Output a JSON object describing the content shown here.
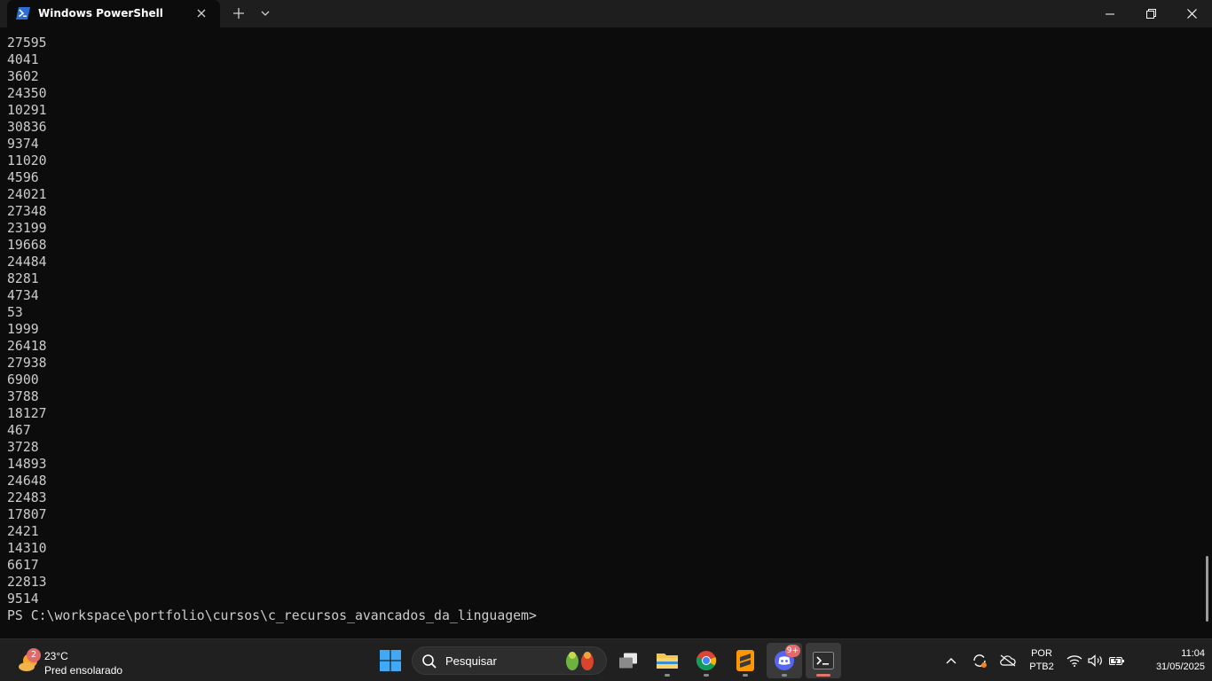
{
  "window": {
    "tab_title": "Windows PowerShell",
    "tab_icon": "powershell-icon"
  },
  "terminal": {
    "output_lines": [
      "27595",
      "4041",
      "3602",
      "24350",
      "10291",
      "30836",
      "9374",
      "11020",
      "4596",
      "24021",
      "27348",
      "23199",
      "19668",
      "24484",
      "8281",
      "4734",
      "53",
      "1999",
      "26418",
      "27938",
      "6900",
      "3788",
      "18127",
      "467",
      "3728",
      "14893",
      "24648",
      "22483",
      "17807",
      "2421",
      "14310",
      "6617",
      "22813",
      "9514"
    ],
    "prompt": "PS C:\\workspace\\portfolio\\cursos\\c_recursos_avancados_da_linguagem>"
  },
  "taskbar": {
    "weather": {
      "badge": "2",
      "temperature": "23°C",
      "description": "Pred ensolarado"
    },
    "search": {
      "placeholder": "Pesquisar"
    },
    "discord_badge": "9+",
    "language": {
      "line1": "POR",
      "line2": "PTB2"
    },
    "clock": {
      "time": "11:04",
      "date": "31/05/2025"
    }
  },
  "colors": {
    "terminal_bg": "#0c0c0c",
    "terminal_text": "#cccccc",
    "titlebar_bg": "#1e1e1e",
    "taskbar_bg": "#202020",
    "accent_red": "#e26a6a"
  }
}
